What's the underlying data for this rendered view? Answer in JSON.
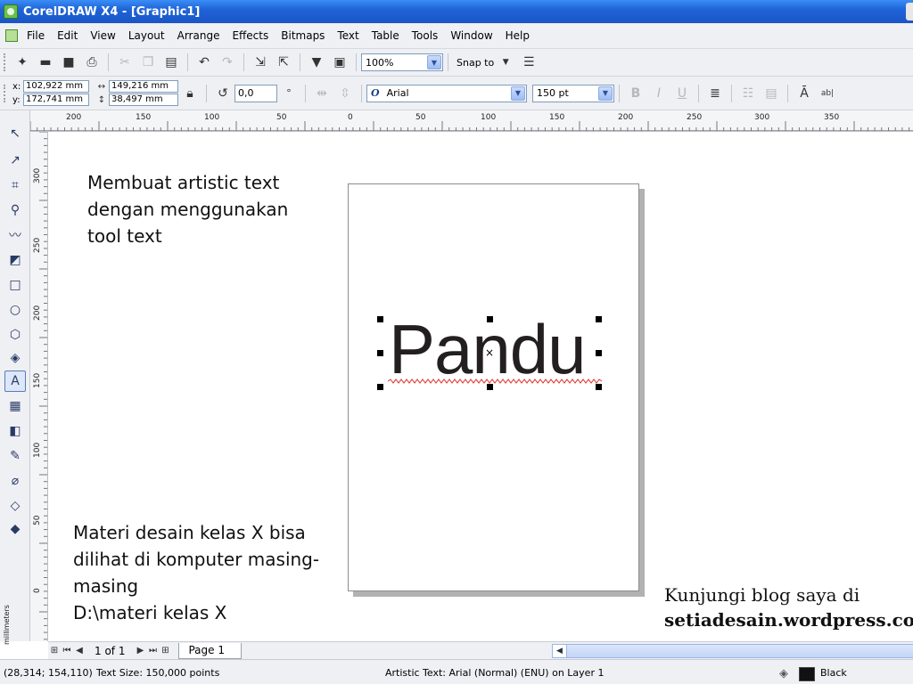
{
  "window": {
    "title": "CorelDRAW X4 - [Graphic1]"
  },
  "menu": [
    "File",
    "Edit",
    "View",
    "Layout",
    "Arrange",
    "Effects",
    "Bitmaps",
    "Text",
    "Table",
    "Tools",
    "Window",
    "Help"
  ],
  "standard_toolbar": {
    "zoom": "100%",
    "snap_to": "Snap to"
  },
  "property_bar": {
    "x_label": "x:",
    "y_label": "y:",
    "x": "102,922 mm",
    "y": "172,741 mm",
    "width": "149,216 mm",
    "height": "38,497 mm",
    "angle": "0,0",
    "angle_unit": "°",
    "font": "Arial",
    "font_size": "150 pt"
  },
  "rulers": {
    "top": [
      "200",
      "150",
      "100",
      "50",
      "0",
      "50",
      "100",
      "150",
      "200",
      "250",
      "300",
      "350"
    ],
    "left": [
      "300",
      "250",
      "200",
      "150",
      "100",
      "50",
      "0"
    ],
    "unit": "millimeters"
  },
  "canvas": {
    "note_top": "Membuat artistic text dengan menggunakan tool text",
    "note_bottom": [
      "Materi desain kelas X bisa",
      "dilihat di komputer masing-",
      "masing",
      "D:\\materi kelas X"
    ],
    "blog_line1": "Kunjungi blog saya di",
    "blog_line2": "setiadesain.wordpress.com",
    "artistic_text": "Pandu"
  },
  "page_nav": {
    "counter": "1 of 1",
    "tab": "Page 1"
  },
  "status": {
    "coords": "(28,314; 154,110)",
    "info": "Text Size: 150,000 points",
    "object": "Artistic Text: Arial (Normal) (ENU) on Layer 1",
    "fill_color": "Black",
    "fill_hex": "#111111"
  }
}
